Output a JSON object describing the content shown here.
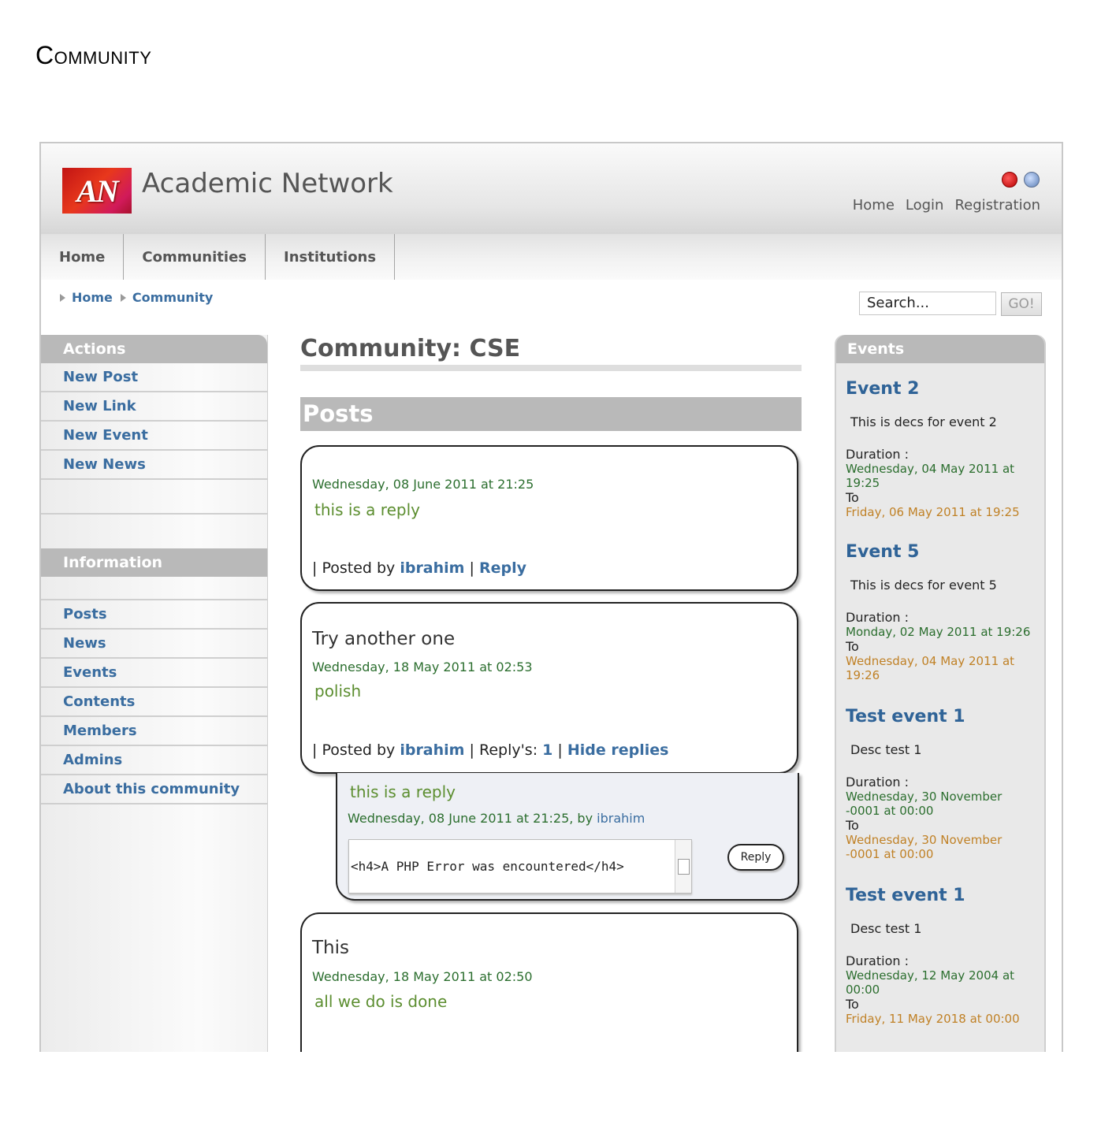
{
  "doc_heading": "Community",
  "site": {
    "logo_text": "AN",
    "title": "Academic Network"
  },
  "top_links": [
    "Home",
    "Login",
    "Registration"
  ],
  "nav": [
    "Home",
    "Communities",
    "Institutions"
  ],
  "breadcrumb": [
    "Home",
    "Community"
  ],
  "search": {
    "value": "Search...",
    "button": "GO!"
  },
  "actions": {
    "heading": "Actions",
    "items": [
      "New Post",
      "New Link",
      "New Event",
      "New News"
    ]
  },
  "information": {
    "heading": "Information",
    "items": [
      "Posts",
      "News",
      "Events",
      "Contents",
      "Members",
      "Admins",
      "About this community"
    ]
  },
  "main": {
    "title": "Community: CSE",
    "posts_heading": "Posts"
  },
  "posts": [
    {
      "title": "",
      "date": "Wednesday, 08 June 2011 at 21:25",
      "body": "this is a reply",
      "footer_prefix": "| Posted by ",
      "author": "ibrahim",
      "sep": " | ",
      "reply_label": "Reply"
    },
    {
      "title": "Try another one",
      "date": "Wednesday, 18 May 2011 at 02:53",
      "body": "polish",
      "footer_prefix": "| Posted by ",
      "author": "ibrahim",
      "replies_text": " | Reply's: ",
      "replies_count": "1",
      "sep": " | ",
      "hide_label": "Hide replies",
      "reply": {
        "text": "this is a reply",
        "meta": "Wednesday, 08 June 2011 at 21:25, by ",
        "author": "ibrahim",
        "textarea_value": "<h4>A PHP Error was encountered</h4>",
        "button": "Reply"
      }
    },
    {
      "title": "This",
      "date": "Wednesday, 18 May 2011 at 02:50",
      "body": "all we do is done"
    }
  ],
  "events": {
    "heading": "Events",
    "items": [
      {
        "title": "Event 2",
        "desc": "This is decs for event 2",
        "duration_label": "Duration :",
        "start": "Wednesday, 04 May 2011 at 19:25",
        "to": "To",
        "end": "Friday, 06 May 2011 at 19:25"
      },
      {
        "title": "Event 5",
        "desc": "This is decs for event 5",
        "duration_label": "Duration :",
        "start": "Monday, 02 May 2011 at 19:26",
        "to": "To",
        "end": "Wednesday, 04 May 2011 at 19:26"
      },
      {
        "title": "Test event 1",
        "desc": "Desc test 1",
        "duration_label": "Duration :",
        "start": "Wednesday, 30 November -0001 at 00:00",
        "to": "To",
        "end": "Wednesday, 30 November -0001 at 00:00"
      },
      {
        "title": "Test event 1",
        "desc": "Desc test 1",
        "duration_label": "Duration :",
        "start": "Wednesday, 12 May 2004 at 00:00",
        "to": "To",
        "end": "Friday, 11 May 2018 at 00:00"
      }
    ]
  }
}
